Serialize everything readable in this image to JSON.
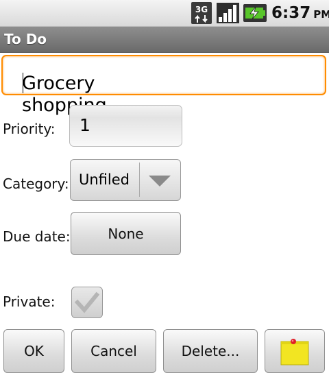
{
  "status_bar": {
    "time": "6:37",
    "ampm": "PM",
    "icons": [
      "3g-data-icon",
      "signal-strength-icon",
      "battery-charging-icon"
    ]
  },
  "title_bar": {
    "title": "To Do"
  },
  "form": {
    "description_value": "Grocery shopping",
    "priority_label": "Priority:",
    "priority_value": "1",
    "category_label": "Category:",
    "category_value": "Unfiled",
    "due_date_label": "Due date:",
    "due_date_value": "None",
    "private_label": "Private:",
    "private_checked": true
  },
  "buttons": {
    "ok": "OK",
    "cancel": "Cancel",
    "delete": "Delete...",
    "note_icon": "sticky-note-icon"
  },
  "colors": {
    "focus_border": "#ff8c00",
    "title_bar": "#7a7a7a",
    "note_yellow": "#f2e522",
    "pin_red": "#e0202a"
  }
}
